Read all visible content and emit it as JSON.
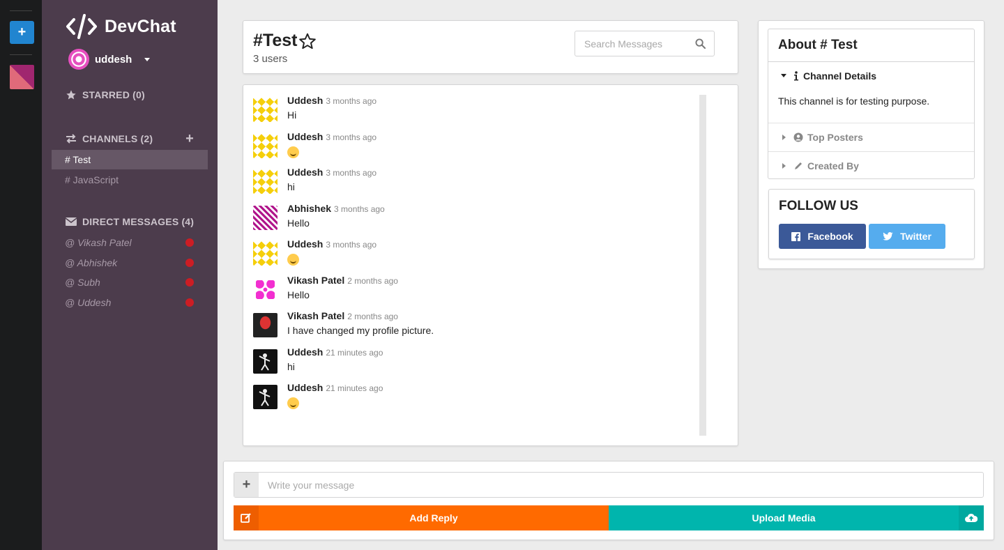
{
  "app": {
    "name": "DevChat",
    "user": "uddesh"
  },
  "sidebar": {
    "starred_label": "STARRED (0)",
    "channels_label": "CHANNELS (2)",
    "channels": [
      "# Test",
      "# JavaScript"
    ],
    "dms_label": "DIRECT MESSAGES (4)",
    "dms": [
      "@ Vikash Patel",
      "@ Abhishek",
      "@ Subh",
      "@ Uddesh"
    ]
  },
  "channel": {
    "title": "#Test",
    "users": "3 users",
    "search_placeholder": "Search Messages"
  },
  "messages": [
    {
      "author": "Uddesh",
      "time": "3 months ago",
      "text": "Hi",
      "emoji": false,
      "avatar": "yellow"
    },
    {
      "author": "Uddesh",
      "time": "3 months ago",
      "text": "",
      "emoji": true,
      "avatar": "yellow"
    },
    {
      "author": "Uddesh",
      "time": "3 months ago",
      "text": "hi",
      "emoji": false,
      "avatar": "yellow"
    },
    {
      "author": "Abhishek",
      "time": "3 months ago",
      "text": "Hello",
      "emoji": false,
      "avatar": "magenta"
    },
    {
      "author": "Uddesh",
      "time": "3 months ago",
      "text": "",
      "emoji": true,
      "avatar": "yellow"
    },
    {
      "author": "Vikash Patel",
      "time": "2 months ago",
      "text": "Hello",
      "emoji": false,
      "avatar": "pink"
    },
    {
      "author": "Vikash Patel",
      "time": "2 months ago",
      "text": "I have changed my profile picture.",
      "emoji": false,
      "avatar": "photo"
    },
    {
      "author": "Uddesh",
      "time": "21 minutes ago",
      "text": "hi",
      "emoji": false,
      "avatar": "dab"
    },
    {
      "author": "Uddesh",
      "time": "21 minutes ago",
      "text": "",
      "emoji": true,
      "avatar": "dab"
    }
  ],
  "composer": {
    "placeholder": "Write your message",
    "reply_label": "Add Reply",
    "upload_label": "Upload Media"
  },
  "about": {
    "title": "About # Test",
    "details_label": "Channel Details",
    "description": "This channel is for testing purpose.",
    "top_posters_label": "Top Posters",
    "created_by_label": "Created By"
  },
  "follow": {
    "title": "FOLLOW US",
    "facebook_label": "Facebook",
    "twitter_label": "Twitter"
  },
  "colors": {
    "sidebar": "#4c3c4c",
    "rail": "#1b1c1d",
    "reply": "#ff6a00",
    "upload": "#00b5ad",
    "facebook": "#3b5998",
    "twitter": "#55acee",
    "dm_dot": "#cc1d24"
  }
}
